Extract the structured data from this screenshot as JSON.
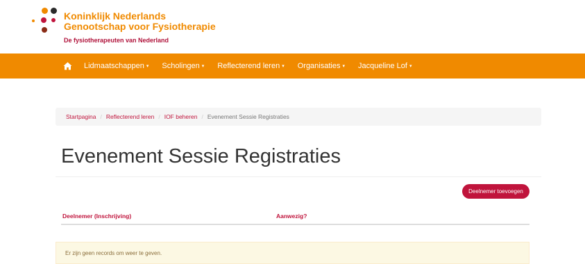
{
  "brand": {
    "name_line1": "Koninklijk Nederlands",
    "name_line2": "Genootschap voor Fysiotherapie",
    "tagline": "De fysiotherapeuten van Nederland",
    "colors": {
      "orange": "#f08a00",
      "crimson": "#c0143c",
      "dark": "#333333",
      "brown": "#8a2c16"
    }
  },
  "nav": {
    "home_icon": "home-icon",
    "items": [
      {
        "label": "Lidmaatschappen",
        "caret": "▾"
      },
      {
        "label": "Scholingen",
        "caret": "▾"
      },
      {
        "label": "Reflecterend leren",
        "caret": "▾"
      },
      {
        "label": "Organisaties",
        "caret": "▾"
      },
      {
        "label": "Jacqueline Lof",
        "caret": "▾"
      }
    ]
  },
  "breadcrumb": {
    "items": [
      "Startpagina",
      "Reflecterend leren",
      "IOF beheren"
    ],
    "separator": "/",
    "active": "Evenement Sessie Registraties"
  },
  "page": {
    "title": "Evenement Sessie Registraties",
    "add_button": "Deelnemer toevoegen"
  },
  "table": {
    "columns": [
      "Deelnemer (Inschrijving)",
      "Aanwezig?"
    ],
    "rows": [],
    "empty_message": "Er zijn geen records om weer te geven."
  }
}
